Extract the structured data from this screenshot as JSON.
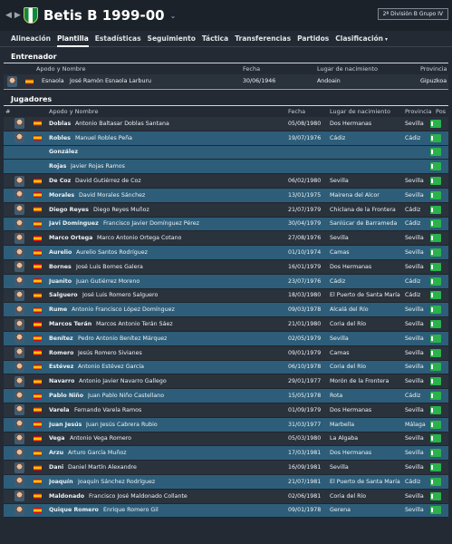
{
  "header": {
    "club_name": "Betis B 1999-00",
    "division": "2ª División B Grupo IV"
  },
  "tabs": [
    {
      "label": "Alineación",
      "active": false
    },
    {
      "label": "Plantilla",
      "active": true
    },
    {
      "label": "Estadísticas",
      "active": false
    },
    {
      "label": "Seguimiento",
      "active": false
    },
    {
      "label": "Táctica",
      "active": false
    },
    {
      "label": "Transferencias",
      "active": false
    },
    {
      "label": "Partidos",
      "active": false
    },
    {
      "label": "Clasificación",
      "active": false
    }
  ],
  "coach_section": {
    "title": "Entrenador",
    "columns": {
      "name": "Apodo y Nombre",
      "date": "Fecha",
      "birthplace": "Lugar de nacimiento",
      "province": "Provincia"
    },
    "coach": {
      "surname": "Esnaola",
      "fullname": "José Ramón Esnaola Larburu",
      "date": "30/06/1946",
      "birthplace": "Andoain",
      "province": "Gipuzkoa"
    }
  },
  "players_section": {
    "title": "Jugadores",
    "columns": {
      "num": "#",
      "name": "Apodo y Nombre",
      "date": "Fecha",
      "birthplace": "Lugar de nacimiento",
      "province": "Provincia",
      "pos": "Pos"
    },
    "players": [
      {
        "surname": "Doblas",
        "fullname": "Antonio Baltasar Doblas Santana",
        "date": "05/08/1980",
        "birthplace": "Dos Hermanas",
        "province": "Sevilla",
        "style": "dark",
        "avatar": true,
        "flag": true
      },
      {
        "surname": "Robles",
        "fullname": "Manuel Robles Peña",
        "date": "19/07/1976",
        "birthplace": "Cádiz",
        "province": "Cádiz",
        "style": "blue",
        "avatar": true,
        "flag": true
      },
      {
        "surname": "González",
        "fullname": "",
        "date": "",
        "birthplace": "",
        "province": "",
        "style": "blue",
        "avatar": false,
        "flag": false
      },
      {
        "surname": "Rojas",
        "fullname": "Javier Rojas Ramos",
        "date": "",
        "birthplace": "",
        "province": "",
        "style": "blue",
        "avatar": false,
        "flag": false
      },
      {
        "surname": "De Coz",
        "fullname": "David Gutiérrez de Coz",
        "date": "06/02/1980",
        "birthplace": "Sevilla",
        "province": "Sevilla",
        "style": "dark",
        "avatar": true,
        "flag": true
      },
      {
        "surname": "Morales",
        "fullname": "David Morales Sánchez",
        "date": "13/01/1975",
        "birthplace": "Mairena del Alcor",
        "province": "Sevilla",
        "style": "blue",
        "avatar": true,
        "flag": true
      },
      {
        "surname": "Diego Reyes",
        "fullname": "Diego Reyes Muñoz",
        "date": "21/07/1979",
        "birthplace": "Chiclana de la Frontera",
        "province": "Cádiz",
        "style": "dark",
        "avatar": true,
        "flag": true
      },
      {
        "surname": "Javi Domínguez",
        "fullname": "Francisco Javier Domínguez Pérez",
        "date": "30/04/1979",
        "birthplace": "Sanlúcar de Barrameda",
        "province": "Cádiz",
        "style": "blue",
        "avatar": true,
        "flag": true
      },
      {
        "surname": "Marco Ortega",
        "fullname": "Marco Antonio Ortega Cotano",
        "date": "27/08/1976",
        "birthplace": "Sevilla",
        "province": "Sevilla",
        "style": "dark",
        "avatar": true,
        "flag": true
      },
      {
        "surname": "Aurelio",
        "fullname": "Aurelio Santos Rodríguez",
        "date": "01/10/1974",
        "birthplace": "Camas",
        "province": "Sevilla",
        "style": "blue",
        "avatar": true,
        "flag": true
      },
      {
        "surname": "Bornes",
        "fullname": "José Luis Bornes Galera",
        "date": "16/01/1979",
        "birthplace": "Dos Hermanas",
        "province": "Sevilla",
        "style": "dark",
        "avatar": true,
        "flag": true
      },
      {
        "surname": "Juanito",
        "fullname": "Juan Gutiérrez Moreno",
        "date": "23/07/1976",
        "birthplace": "Cádiz",
        "province": "Cádiz",
        "style": "blue",
        "avatar": true,
        "flag": true
      },
      {
        "surname": "Salguero",
        "fullname": "José Luis Romero Salguero",
        "date": "18/03/1980",
        "birthplace": "El Puerto de Santa María",
        "province": "Cádiz",
        "style": "dark",
        "avatar": true,
        "flag": true
      },
      {
        "surname": "Rume",
        "fullname": "Antonio Francisco López Domínguez",
        "date": "09/03/1978",
        "birthplace": "Alcalá del Río",
        "province": "Sevilla",
        "style": "blue",
        "avatar": true,
        "flag": true
      },
      {
        "surname": "Marcos Terán",
        "fullname": "Marcos Antonio Terán Sáez",
        "date": "21/01/1980",
        "birthplace": "Coria del Río",
        "province": "Sevilla",
        "style": "dark",
        "avatar": true,
        "flag": true
      },
      {
        "surname": "Benítez",
        "fullname": "Pedro Antonio Benítez Márquez",
        "date": "02/05/1979",
        "birthplace": "Sevilla",
        "province": "Sevilla",
        "style": "blue",
        "avatar": true,
        "flag": true
      },
      {
        "surname": "Romero",
        "fullname": "Jesús Romero Sivianes",
        "date": "09/01/1979",
        "birthplace": "Camas",
        "province": "Sevilla",
        "style": "dark",
        "avatar": true,
        "flag": true
      },
      {
        "surname": "Estévez",
        "fullname": "Antonio Estévez García",
        "date": "06/10/1978",
        "birthplace": "Coria del Río",
        "province": "Sevilla",
        "style": "blue",
        "avatar": true,
        "flag": true
      },
      {
        "surname": "Navarro",
        "fullname": "Antonio Javier Navarro Gallego",
        "date": "29/01/1977",
        "birthplace": "Morón de la Frontera",
        "province": "Sevilla",
        "style": "dark",
        "avatar": true,
        "flag": true
      },
      {
        "surname": "Pablo Niño",
        "fullname": "Juan Pablo Niño Castellano",
        "date": "15/05/1978",
        "birthplace": "Rota",
        "province": "Cádiz",
        "style": "blue",
        "avatar": true,
        "flag": true
      },
      {
        "surname": "Varela",
        "fullname": "Fernando Varela Ramos",
        "date": "01/09/1979",
        "birthplace": "Dos Hermanas",
        "province": "Sevilla",
        "style": "dark",
        "avatar": true,
        "flag": true
      },
      {
        "surname": "Juan Jesús",
        "fullname": "Juan Jesús Cabrera Rubio",
        "date": "31/03/1977",
        "birthplace": "Marbella",
        "province": "Málaga",
        "style": "blue",
        "avatar": true,
        "flag": true
      },
      {
        "surname": "Vega",
        "fullname": "Antonio Vega Romero",
        "date": "05/03/1980",
        "birthplace": "La Algaba",
        "province": "Sevilla",
        "style": "dark",
        "avatar": true,
        "flag": true
      },
      {
        "surname": "Arzu",
        "fullname": "Arturo García Muñoz",
        "date": "17/03/1981",
        "birthplace": "Dos Hermanas",
        "province": "Sevilla",
        "style": "blue",
        "avatar": true,
        "flag": true
      },
      {
        "surname": "Dani",
        "fullname": "Daniel Martín Alexandre",
        "date": "16/09/1981",
        "birthplace": "Sevilla",
        "province": "Sevilla",
        "style": "dark",
        "avatar": true,
        "flag": true
      },
      {
        "surname": "Joaquín",
        "fullname": "Joaquín Sánchez Rodríguez",
        "date": "21/07/1981",
        "birthplace": "El Puerto de Santa María",
        "province": "Cádiz",
        "style": "blue",
        "avatar": true,
        "flag": true
      },
      {
        "surname": "Maldonado",
        "fullname": "Francisco José Maldonado Collante",
        "date": "02/06/1981",
        "birthplace": "Coria del Río",
        "province": "Sevilla",
        "style": "dark",
        "avatar": true,
        "flag": true
      },
      {
        "surname": "Quique Romero",
        "fullname": "Enrique Romero Gil",
        "date": "09/01/1978",
        "birthplace": "Gerena",
        "province": "Sevilla",
        "style": "blue",
        "avatar": true,
        "flag": true
      }
    ]
  }
}
